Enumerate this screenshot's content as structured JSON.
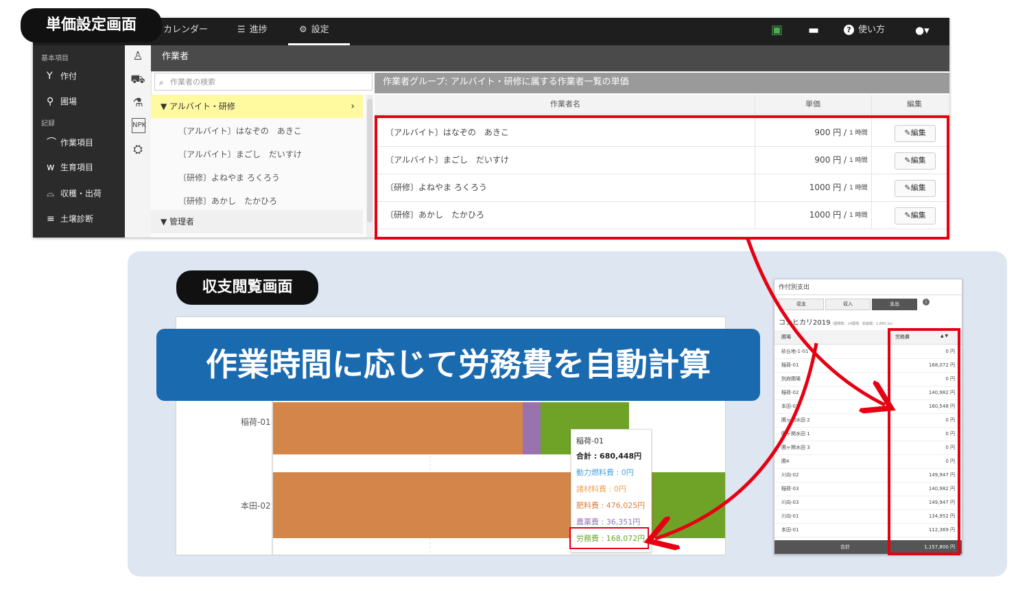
{
  "labels": {
    "unit_price_screen": "単価設定画面",
    "budget_screen": "収支閲覧画面",
    "banner": "作業時間に応じて労務費を自動計算"
  },
  "navbar": {
    "calendar": "カレンダー",
    "progress": "進捗",
    "settings": "設定",
    "help": "使い方",
    "icons": [
      "calendar-icon",
      "list-icon",
      "gear-icon",
      "sheet-icon",
      "message-icon",
      "help-icon",
      "user-icon"
    ]
  },
  "sidebar": {
    "section_basic": "基本項目",
    "crop": "作付",
    "field": "圃場",
    "section_record": "記録",
    "work_item": "作業項目",
    "growth_item": "生育項目",
    "harvest": "収穫・出荷",
    "soil": "土壌診断"
  },
  "workers_panel": {
    "header": "作業者",
    "search_placeholder": "作業者の検索",
    "group_alba": "▼ アルバイト・研修",
    "group_manager": "▼ 管理者",
    "workers": [
      "〔アルバイト〕はなぞの　あきこ",
      "〔アルバイト〕まごし　だいすけ",
      "〔研修〕よねやま ろくろう",
      "〔研修〕あかし　たかひろ"
    ]
  },
  "price_table": {
    "title": "作業者グループ: アルバイト・研修に属する作業者一覧の単価",
    "col_name": "作業者名",
    "col_price": "単価",
    "col_edit": "編集",
    "edit_label": "編集",
    "unit": "1 時間",
    "rows": [
      {
        "name": "〔アルバイト〕はなぞの　あきこ",
        "price": "900 円 /"
      },
      {
        "name": "〔アルバイト〕まごし　だいすけ",
        "price": "900 円 /"
      },
      {
        "name": "〔研修〕よねやま ろくろう",
        "price": "1000 円 /"
      },
      {
        "name": "〔研修〕あかし　たかひろ",
        "price": "1000 円 /"
      }
    ]
  },
  "chart_data": {
    "type": "bar",
    "orientation": "horizontal",
    "stacked": true,
    "categories": [
      "稲荷-01",
      "本田-02"
    ],
    "series": [
      {
        "name": "肥料費",
        "color": "#d4854a"
      },
      {
        "name": "農薬費",
        "color": "#9b72b0"
      },
      {
        "name": "労務費",
        "color": "#6ea328"
      }
    ],
    "tooltip": {
      "title": "稲荷-01",
      "total": "合計 : 680,448円",
      "fuel": "動力燃料費 : 0円",
      "materials": "諸材料費 : 0円",
      "fertilizer": "肥料費 : 476,025円",
      "pesticide": "農薬費 : 36,351円",
      "labor": "労務費 : 168,072円"
    },
    "tooltip_colors": {
      "fuel": "#4aa3df",
      "materials": "#f0a04b",
      "fertilizer": "#e07b39",
      "pesticide": "#9b72b0",
      "labor": "#6ea328"
    }
  },
  "crop_expense": {
    "title": "作付別支出",
    "tabs": [
      "収支",
      "収入",
      "支出"
    ],
    "crop": "コシヒカリ2019",
    "crop_note": "(圃場数：14圃場、総面積：1,890.3a)",
    "col_field": "圃場",
    "col_labor": "労務費",
    "rows": [
      {
        "field": "砂丘地-1-01",
        "labor": "0 円"
      },
      {
        "field": "稲荷-01",
        "labor": "168,072 円"
      },
      {
        "field": "別府圃場",
        "labor": "0 円"
      },
      {
        "field": "稲荷-02",
        "labor": "140,982 円"
      },
      {
        "field": "本田-02",
        "labor": "160,548 円"
      },
      {
        "field": "圃ヶ関水田 2",
        "labor": "0 円"
      },
      {
        "field": "圃ヶ関水田 1",
        "labor": "0 円"
      },
      {
        "field": "圃ヶ関水田 3",
        "labor": "0 円"
      },
      {
        "field": "圃4",
        "labor": "0 円"
      },
      {
        "field": "川向-02",
        "labor": "149,947 円"
      },
      {
        "field": "稲荷-03",
        "labor": "140,982 円"
      },
      {
        "field": "川向-03",
        "labor": "149,947 円"
      },
      {
        "field": "川向-01",
        "labor": "134,952 円"
      },
      {
        "field": "本田-01",
        "labor": "112,369 円"
      }
    ],
    "total_label": "合計",
    "total_value": "1,157,800 円"
  }
}
